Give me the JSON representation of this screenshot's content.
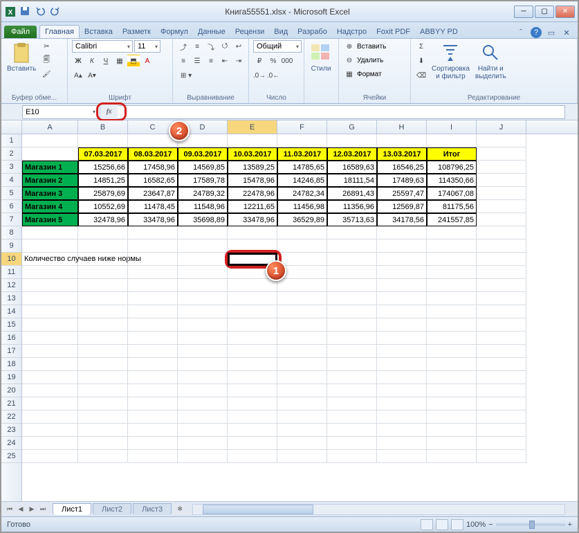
{
  "title": "Книга55551.xlsx - Microsoft Excel",
  "tabs": {
    "file": "Файл",
    "home": "Главная",
    "insert": "Вставка",
    "layout": "Разметк",
    "formulas": "Формул",
    "data": "Данные",
    "review": "Рецензи",
    "view": "Вид",
    "dev": "Разрабо",
    "addins": "Надстро",
    "foxit": "Foxit PDF",
    "abbyy": "ABBYY PD"
  },
  "ribbon": {
    "clipboard": {
      "paste": "Вставить",
      "label": "Буфер обме..."
    },
    "font": {
      "name": "Calibri",
      "size": "11",
      "label": "Шрифт"
    },
    "align": {
      "label": "Выравнивание"
    },
    "number": {
      "fmt": "Общий",
      "label": "Число"
    },
    "styles": {
      "btn": "Стили"
    },
    "cells": {
      "ins": "Вставить",
      "del": "Удалить",
      "fmt": "Формат",
      "label": "Ячейки"
    },
    "editing": {
      "sort": "Сортировка\nи фильтр",
      "find": "Найти и\nвыделить",
      "label": "Редактирование"
    }
  },
  "namebox": "E10",
  "callout1": "1",
  "callout2": "2",
  "columns": [
    "A",
    "B",
    "C",
    "D",
    "E",
    "F",
    "G",
    "H",
    "I",
    "J"
  ],
  "rows_count": 25,
  "sheet": {
    "header_row": [
      "",
      "07.03.2017",
      "08.03.2017",
      "09.03.2017",
      "10.03.2017",
      "11.03.2017",
      "12.03.2017",
      "13.03.2017",
      "Итог"
    ],
    "data": [
      [
        "Магазин 1",
        "15256,66",
        "17458,96",
        "14569,85",
        "13589,25",
        "14785,65",
        "16589,63",
        "16546,25",
        "108796,25"
      ],
      [
        "Магазин 2",
        "14851,25",
        "16582,65",
        "17589,78",
        "15478,96",
        "14246,85",
        "18111,54",
        "17489,63",
        "114350,66"
      ],
      [
        "Магазин 3",
        "25879,69",
        "23647,87",
        "24789,32",
        "22478,96",
        "24782,34",
        "26891,43",
        "25597,47",
        "174067,08"
      ],
      [
        "Магазин 4",
        "10552,69",
        "11478,45",
        "11548,96",
        "12211,65",
        "11456,98",
        "11356,96",
        "12569,87",
        "81175,56"
      ],
      [
        "Магазин 5",
        "32478,96",
        "33478,96",
        "35698,89",
        "33478,96",
        "36529,89",
        "35713,63",
        "34178,56",
        "241557,85"
      ]
    ],
    "label_row": 10,
    "label_text": "Количество случаев ниже нормы"
  },
  "sheets": [
    "Лист1",
    "Лист2",
    "Лист3"
  ],
  "status": "Готово",
  "zoom": "100%"
}
